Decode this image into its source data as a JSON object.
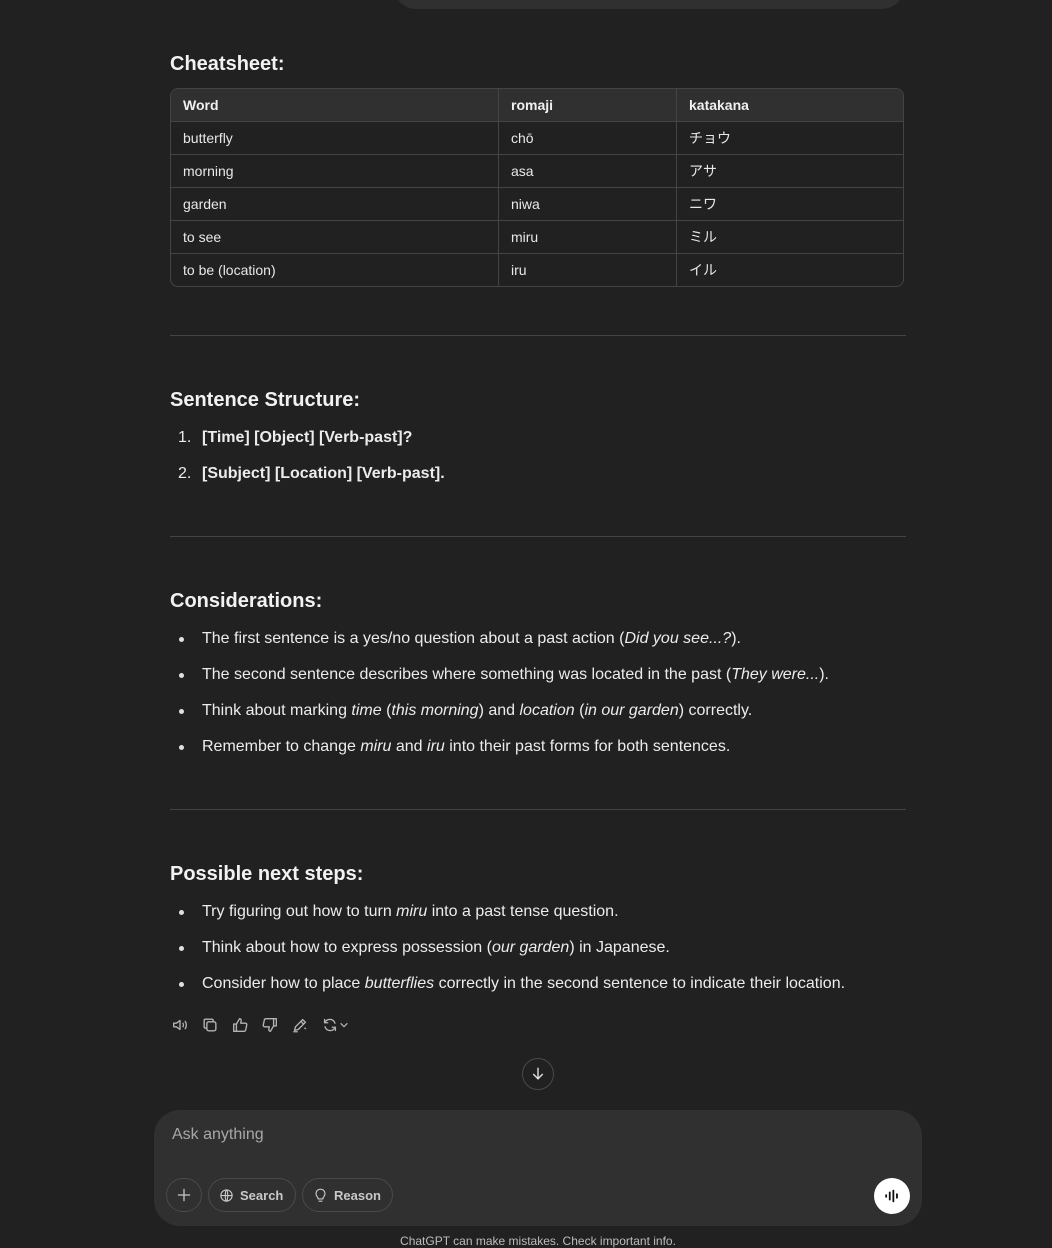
{
  "cheatsheet": {
    "heading": "Cheatsheet:",
    "headers": [
      "Word",
      "romaji",
      "katakana"
    ],
    "rows": [
      [
        "butterfly",
        "chō",
        "チョウ"
      ],
      [
        "morning",
        "asa",
        "アサ"
      ],
      [
        "garden",
        "niwa",
        "ニワ"
      ],
      [
        "to see",
        "miru",
        "ミル"
      ],
      [
        "to be (location)",
        "iru",
        "イル"
      ]
    ]
  },
  "structure": {
    "heading": "Sentence Structure:",
    "items": [
      {
        "num": "1.",
        "text": "[Time] [Object] [Verb-past]?"
      },
      {
        "num": "2.",
        "text": "[Subject] [Location] [Verb-past]."
      }
    ]
  },
  "considerations": {
    "heading": "Considerations:",
    "items": [
      [
        "The first sentence is a yes/no question about a past action (",
        "Did you see...?",
        ")."
      ],
      [
        "The second sentence describes where something was located in the past (",
        "They were...",
        ")."
      ],
      [
        "Think about marking ",
        "time",
        " (",
        "this morning",
        ") and ",
        "location",
        " (",
        "in our garden",
        ") correctly."
      ],
      [
        "Remember to change ",
        "miru",
        " and ",
        "iru",
        " into their past forms for both sentences."
      ]
    ]
  },
  "next_steps": {
    "heading": "Possible next steps:",
    "items": [
      [
        "Try figuring out how to turn ",
        "miru",
        " into a past tense question."
      ],
      [
        "Think about how to express possession (",
        "our garden",
        ") in Japanese."
      ],
      [
        "Consider how to place ",
        "butterflies",
        " correctly in the second sentence to indicate their location."
      ]
    ]
  },
  "actions": [
    "read-aloud-icon",
    "copy-icon",
    "thumbs-up-icon",
    "thumbs-down-icon",
    "edit-icon",
    "regenerate-icon"
  ],
  "composer": {
    "placeholder": "Ask anything",
    "search_label": "Search",
    "reason_label": "Reason"
  },
  "footer": "ChatGPT can make mistakes. Check important info."
}
